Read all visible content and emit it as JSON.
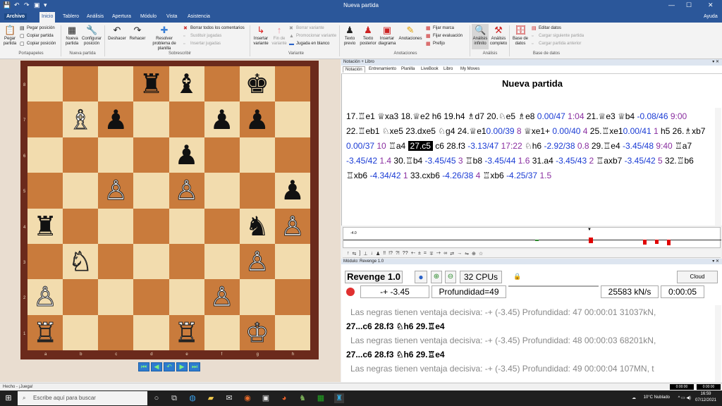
{
  "window": {
    "title": "Nueva partida",
    "help": "Ayuda"
  },
  "ribbon_tabs": [
    "Archivo",
    "Inicio",
    "Tablero",
    "Análisis",
    "Apertura",
    "Módulo",
    "Vista",
    "Asistencia"
  ],
  "ribbon": {
    "pegar_partida": "Pegar partida",
    "pegar_posicion": "Pegar posición",
    "copiar_partida": "Copiar partida",
    "copiar_posicion": "Copiar posición",
    "group_portapapeles": "Portapapeles",
    "nueva_partida": "Nueva partida",
    "configurar_posicion": "Configurar posición",
    "group_nueva_partida": "Nueva partida",
    "deshacer": "Deshacer",
    "rehacer": "Rehacer",
    "resolver": "Resolver problema de planilla",
    "borrar_comentarios": "Borrar todos los comentarios",
    "sustituir_jugadas": "Sustituir jugadas",
    "insertar_jugadas": "Insertar jugadas",
    "group_sobrescribir": "Sobrescribir",
    "insertar_variante": "Insertar variante",
    "fin_variante": "Fin de variante",
    "borrar_variante": "Borrar variante",
    "promocionar_variante": "Promocionar variante",
    "jugada_en_blanco": "Jugada en blanco",
    "group_variante": "Variante",
    "texto_previo": "Texto previo",
    "texto_posterior": "Texto posterior",
    "insertar_diagrama": "Insertar diagrama",
    "anotaciones": "Anotaciones",
    "fijar_marca": "Fijar marca",
    "fijar_evaluacion": "Fijar evaluación",
    "prefijo": "Prefijo",
    "group_anotaciones": "Anotaciones",
    "analisis_infinito": "Análisis infinito",
    "analisis_completo": "Análisis completo",
    "group_analisis": "Análisis",
    "base_de_datos": "Base de datos",
    "editar_datos": "Editar datos",
    "cargar_siguiente": "Cargar siguiente partida",
    "cargar_anterior": "Cargar partida anterior",
    "group_base": "Base de datos"
  },
  "board": {
    "ranks": [
      "8",
      "7",
      "6",
      "5",
      "4",
      "3",
      "2",
      "1"
    ],
    "files": [
      "a",
      "b",
      "c",
      "d",
      "e",
      "f",
      "g",
      "h"
    ],
    "rows": [
      [
        "",
        "",
        "",
        "♜",
        "♝",
        "",
        "♚",
        ""
      ],
      [
        "",
        "♗",
        "♟",
        "",
        "",
        "♟",
        "♟",
        ""
      ],
      [
        "",
        "",
        "",
        "",
        "♟",
        "",
        "",
        ""
      ],
      [
        "",
        "",
        "♙",
        "",
        "♙",
        "",
        "",
        "♟"
      ],
      [
        "♜",
        "",
        "",
        "",
        "",
        "",
        "♞",
        "♙"
      ],
      [
        "",
        "♘",
        "",
        "",
        "",
        "",
        "♙",
        ""
      ],
      [
        "♙",
        "",
        "",
        "",
        "",
        "♙",
        "",
        ""
      ],
      [
        "♖",
        "",
        "",
        "",
        "♖",
        "",
        "♔",
        ""
      ]
    ],
    "colors": [
      [
        "",
        "",
        "",
        "b",
        "b",
        "",
        "b",
        ""
      ],
      [
        "",
        "w",
        "b",
        "",
        "",
        "b",
        "b",
        ""
      ],
      [
        "",
        "",
        "",
        "",
        "b",
        "",
        "",
        ""
      ],
      [
        "",
        "",
        "w",
        "",
        "w",
        "",
        "",
        "b"
      ],
      [
        "b",
        "",
        "",
        "",
        "",
        "",
        "b",
        "w"
      ],
      [
        "",
        "w",
        "",
        "",
        "",
        "",
        "w",
        ""
      ],
      [
        "w",
        "",
        "",
        "",
        "",
        "w",
        "",
        ""
      ],
      [
        "w",
        "",
        "",
        "",
        "w",
        "",
        "w",
        ""
      ]
    ]
  },
  "notation_panel": {
    "header": "Notación + Libro",
    "tabs": [
      "Notación",
      "Entrenamiento",
      "Planilla",
      "LiveBook",
      "Libro",
      "My Moves"
    ],
    "game_title": "Nueva partida",
    "moves": [
      {
        "t": "17.♖e1 ",
        "c": ""
      },
      {
        "t": "♕xa3 ",
        "c": ""
      },
      {
        "t": "18.♕e2 ",
        "c": ""
      },
      {
        "t": "h6 ",
        "c": ""
      },
      {
        "t": "19.h4 ",
        "c": ""
      },
      {
        "t": "♗d7 ",
        "c": ""
      },
      {
        "t": "20.♘e5 ",
        "c": ""
      },
      {
        "t": "♗e8 ",
        "c": ""
      },
      {
        "t": "0.00/47 ",
        "c": "ev"
      },
      {
        "t": "1:04 ",
        "c": "tm"
      },
      {
        "t": "21.♕e3 ",
        "c": ""
      },
      {
        "t": "♕b4 ",
        "c": ""
      },
      {
        "t": "-0.08/46 ",
        "c": "ev"
      },
      {
        "t": "9:00 ",
        "c": "tm"
      },
      {
        "t": "22.♖eb1 ",
        "c": ""
      },
      {
        "t": "♘xe5 ",
        "c": ""
      },
      {
        "t": "23.dxe5 ",
        "c": ""
      },
      {
        "t": "♘g4 ",
        "c": ""
      },
      {
        "t": "24.♕e1",
        "c": ""
      },
      {
        "t": "0.00/39 ",
        "c": "ev"
      },
      {
        "t": "8 ",
        "c": "tm"
      },
      {
        "t": "♕xe1+ ",
        "c": ""
      },
      {
        "t": "0.00/40 ",
        "c": "ev"
      },
      {
        "t": "4 ",
        "c": "tm"
      },
      {
        "t": "25.♖xe1",
        "c": ""
      },
      {
        "t": "0.00/41 ",
        "c": "ev"
      },
      {
        "t": "1 ",
        "c": "tm"
      },
      {
        "t": "h5 ",
        "c": ""
      },
      {
        "t": "26.♗xb7 ",
        "c": ""
      },
      {
        "t": "0.00/37 ",
        "c": "ev"
      },
      {
        "t": "10 ",
        "c": "tm"
      },
      {
        "t": "♖a4 ",
        "c": ""
      },
      {
        "t": "27.c5",
        "c": "cur"
      },
      {
        "t": " c6 ",
        "c": ""
      },
      {
        "t": "28.f3 ",
        "c": ""
      },
      {
        "t": "-3.13/47 ",
        "c": "ev"
      },
      {
        "t": "17:22 ",
        "c": "tm"
      },
      {
        "t": "♘h6 ",
        "c": ""
      },
      {
        "t": "-2.92/38 ",
        "c": "ev"
      },
      {
        "t": "0.8 ",
        "c": "tm"
      },
      {
        "t": "29.♖e4 ",
        "c": ""
      },
      {
        "t": "-3.45/48 ",
        "c": "ev"
      },
      {
        "t": "9:40 ",
        "c": "tm"
      },
      {
        "t": "♖a7 ",
        "c": ""
      },
      {
        "t": "-3.45/42 ",
        "c": "ev"
      },
      {
        "t": "1.4 ",
        "c": "tm"
      },
      {
        "t": "30.♖b4 ",
        "c": ""
      },
      {
        "t": "-3.45/45 ",
        "c": "ev"
      },
      {
        "t": "3 ",
        "c": "tm"
      },
      {
        "t": "♖b8 ",
        "c": ""
      },
      {
        "t": "-3.45/44 ",
        "c": "ev"
      },
      {
        "t": "1.6 ",
        "c": "tm"
      },
      {
        "t": "31.a4 ",
        "c": ""
      },
      {
        "t": "-3.45/43 ",
        "c": "ev"
      },
      {
        "t": "2 ",
        "c": "tm"
      },
      {
        "t": "♖axb7 ",
        "c": ""
      },
      {
        "t": "-3.45/42 ",
        "c": "ev"
      },
      {
        "t": "5 ",
        "c": "tm"
      },
      {
        "t": "32.♖b6 ",
        "c": ""
      },
      {
        "t": "♖xb6 ",
        "c": ""
      },
      {
        "t": "-4.34/42 ",
        "c": "ev"
      },
      {
        "t": "1 ",
        "c": "tm"
      },
      {
        "t": "33.cxb6 ",
        "c": ""
      },
      {
        "t": "-4.26/38 ",
        "c": "ev"
      },
      {
        "t": "4 ",
        "c": "tm"
      },
      {
        "t": "♖xb6 ",
        "c": ""
      },
      {
        "t": "-4.25/37 ",
        "c": "ev"
      },
      {
        "t": "1.5",
        "c": "tm"
      }
    ]
  },
  "eval_graph": {
    "label": "-4.0",
    "current_move_marker": 27
  },
  "annotation_symbols": [
    "↑",
    "⇆",
    "]",
    "⊥",
    "↓",
    "♟",
    "!!",
    "!?",
    "?!",
    "??",
    "+-",
    "±",
    "=",
    "∓",
    "-+",
    "∞",
    "⇄",
    "→",
    "⇋",
    "⊕",
    "☆"
  ],
  "engine_panel": {
    "header": "Módulo: Revenge 1.0",
    "name": "Revenge 1.0",
    "cpus": "32 CPUs",
    "cloud": "Cloud",
    "eval": "-+ -3.45",
    "depth": "Profundidad=49",
    "speed": "25583 kN/s",
    "time": "0:00:05",
    "lines": [
      {
        "text": "Las negras tienen ventaja decisiva: -+ (-3.45)  Profundidad: 47   00:00:01  31037kN,",
        "bold": false
      },
      {
        "text": "27...c6 28.f3 ♘h6 29.♖e4",
        "bold": true
      },
      {
        "text": "Las negras tienen ventaja decisiva: -+ (-3.45)  Profundidad: 48   00:00:03  68201kN,",
        "bold": false
      },
      {
        "text": "27...c6 28.f3 ♘h6 29.♖e4",
        "bold": true
      },
      {
        "text": "Las negras tienen ventaja decisiva: -+ (-3.45)  Profundidad: 49   00:00:04  107MN, t",
        "bold": false
      }
    ]
  },
  "status": {
    "text": "Hecho - ¡Juega!",
    "clock_white": "0:00:00",
    "clock_black": "0:00:00"
  },
  "taskbar": {
    "search_placeholder": "Escribe aquí para buscar",
    "weather": "10°C  Nublado",
    "time": "16:59",
    "date": "07/12/2021"
  }
}
